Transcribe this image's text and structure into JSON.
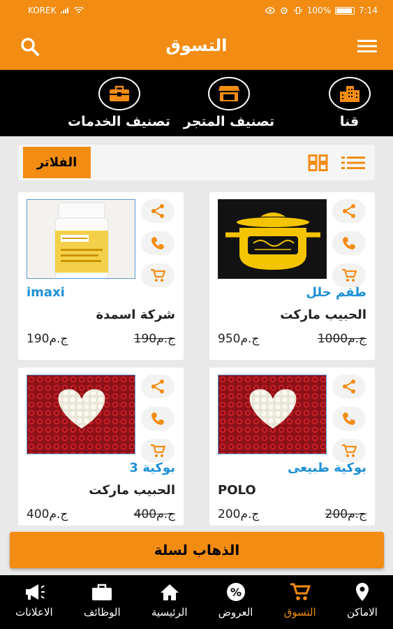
{
  "status": {
    "carrier": "KOREK",
    "battery": "100%",
    "time": "7:14"
  },
  "header": {
    "title": "التسوق"
  },
  "categories": [
    {
      "label": "قنا",
      "icon": "buildings-icon"
    },
    {
      "label": "تصنيف المتجر",
      "icon": "store-icon"
    },
    {
      "label": "تصنيف الخدمات",
      "icon": "briefcase-icon"
    }
  ],
  "filter": {
    "label": "الفلاتر"
  },
  "products": [
    {
      "name": "طقم حلل",
      "store": "الحبيب ماركت",
      "old_price": "1000ج.م",
      "price": "950ج.م",
      "image": "pot-logo"
    },
    {
      "name": "imaxi",
      "store": "شركة اسمدة",
      "old_price": "190ج.م",
      "price": "190ج.م",
      "image": "bottle"
    },
    {
      "name": "بوكية طبيعى",
      "store": "POLO",
      "old_price": "200ج.م",
      "price": "200ج.م",
      "image": "roses-heart"
    },
    {
      "name": "بوكية 3",
      "store": "الحبيب ماركت",
      "old_price": "400ج.م",
      "price": "400ج.م",
      "image": "roses-heart"
    }
  ],
  "cart_button": {
    "label": "الذهاب لسلة"
  },
  "bottom_nav": [
    {
      "label": "الاماكن",
      "icon": "location-pin-icon",
      "active": false
    },
    {
      "label": "التسوق",
      "icon": "cart-icon",
      "active": true
    },
    {
      "label": "العروض",
      "icon": "percent-icon",
      "active": false
    },
    {
      "label": "الرئيسية",
      "icon": "home-icon",
      "active": false
    },
    {
      "label": "الوظائف",
      "icon": "briefcase-icon",
      "active": false
    },
    {
      "label": "الاعلانات",
      "icon": "megaphone-icon",
      "active": false
    }
  ],
  "colors": {
    "accent": "#f28c13",
    "link": "#1e90d6",
    "dark": "#000000"
  }
}
